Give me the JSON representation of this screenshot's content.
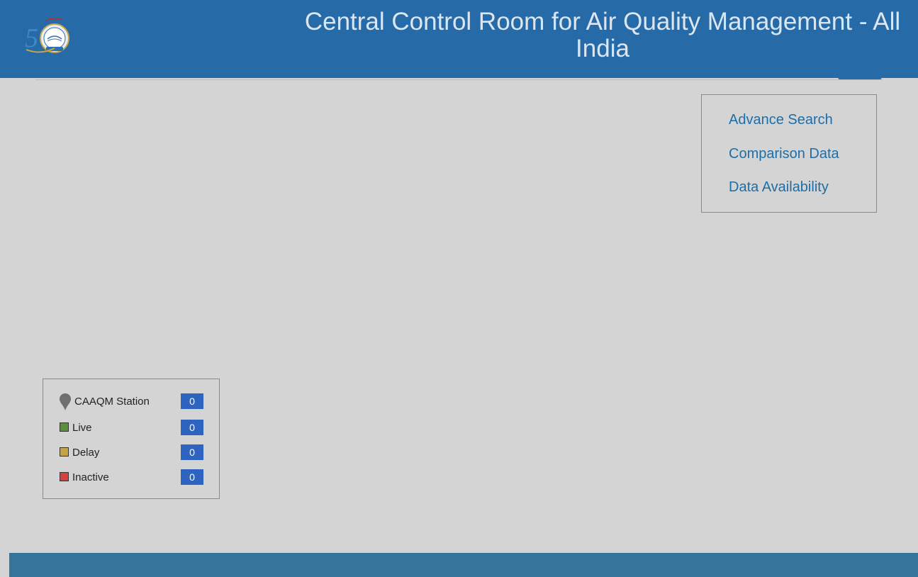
{
  "header": {
    "title": "Central Control Room for Air Quality Management - All India",
    "background_color": "#276aa8",
    "logo_icon": "cpcb-50-years-logo"
  },
  "links": [
    {
      "label": "Advance Search"
    },
    {
      "label": "Comparison Data"
    },
    {
      "label": "Data Availability"
    }
  ],
  "legend": {
    "station": {
      "label": "CAAQM Station",
      "count": "0",
      "icon": "map-pin-icon"
    },
    "items": [
      {
        "label": "Live",
        "count": "0",
        "color": "#5b8f3a"
      },
      {
        "label": "Delay",
        "count": "0",
        "color": "#c4a345"
      },
      {
        "label": "Inactive",
        "count": "0",
        "color": "#d8403e"
      }
    ],
    "count_color": "#2e64bf"
  },
  "footer": {
    "background_color": "#37749c"
  }
}
